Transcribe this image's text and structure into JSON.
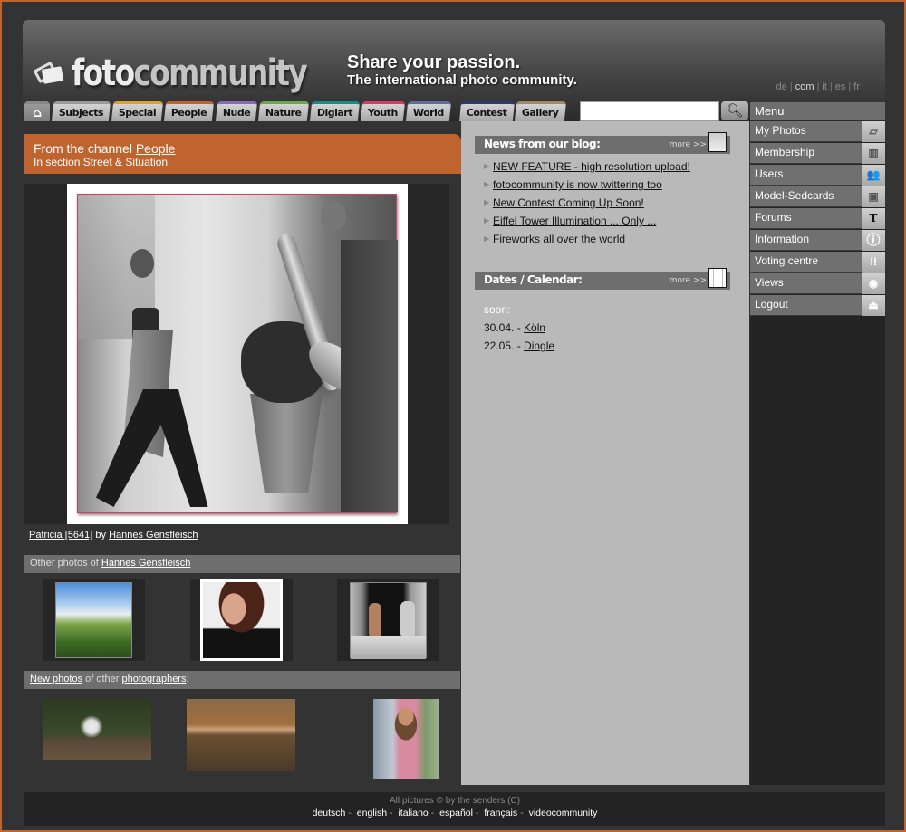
{
  "header": {
    "logo_foto": "foto",
    "logo_community": "community",
    "tagline_main": "Share your passion.",
    "tagline_sub": "The international photo community.",
    "languages": [
      "de",
      "com",
      "it",
      "es",
      "fr"
    ],
    "selected_language": "com"
  },
  "tabs": [
    {
      "label": "Subjects",
      "color": "#9a9a9a"
    },
    {
      "label": "Special",
      "color": "#e0a030"
    },
    {
      "label": "People",
      "color": "#c0642f"
    },
    {
      "label": "Nude",
      "color": "#8a6ab8"
    },
    {
      "label": "Nature",
      "color": "#6aa84f"
    },
    {
      "label": "Digiart",
      "color": "#138f8a"
    },
    {
      "label": "Youth",
      "color": "#d63c63"
    },
    {
      "label": "World",
      "color": "#5c6e9c"
    },
    {
      "label": "Contest",
      "color": "#2f3a6a"
    },
    {
      "label": "Gallery",
      "color": "#a08a64"
    }
  ],
  "search": {
    "value": "",
    "placeholder": ""
  },
  "channel": {
    "prefix": "From the channel",
    "channel_name": "People",
    "section_prefix": "In section Stree",
    "section_name": "t & Situation"
  },
  "main_photo": {
    "title": "Patricia [5641]",
    "by": "by",
    "author": "Hannes Gensfleisch"
  },
  "other_photos": {
    "prefix": "Other photos of",
    "author": "Hannes Gensfleisch",
    "thumbs": [
      "landscape",
      "portrait",
      "balcony"
    ]
  },
  "new_photos": {
    "link1": "New photos",
    "middle": "of other",
    "link2": "photographers",
    "suffix": ":",
    "thumbs": [
      "star-sculpture",
      "reclining-figure",
      "woman-portrait"
    ]
  },
  "blog": {
    "title": "News from our blog:",
    "more": "more >>",
    "items": [
      "NEW FEATURE - high resolution upload!",
      "fotocommunity is now twittering too",
      "New Contest Coming Up Soon!",
      "Eiffel Tower Illumination ... Only ...",
      "Fireworks all over the world"
    ]
  },
  "calendar": {
    "title": "Dates / Calendar:",
    "more": "more >>",
    "soon_label": "soon:",
    "events": [
      {
        "date": "30.04. -",
        "place": "Köln"
      },
      {
        "date": "22.05. -",
        "place": "Dingle"
      }
    ]
  },
  "menu": {
    "title": "Menu",
    "items": [
      {
        "label": "My Photos",
        "icon": "photos-icon",
        "glyph": "▱"
      },
      {
        "label": "Membership",
        "icon": "membership-icon",
        "glyph": "▥"
      },
      {
        "label": "Users",
        "icon": "users-icon",
        "glyph": "👥"
      },
      {
        "label": "Model-Sedcards",
        "icon": "sedcard-icon",
        "glyph": "▣"
      },
      {
        "label": "Forums",
        "icon": "forum-icon",
        "glyph": "T"
      },
      {
        "label": "Information",
        "icon": "info-icon",
        "glyph": "ⓘ"
      },
      {
        "label": "Voting centre",
        "icon": "voting-icon",
        "glyph": "!!"
      },
      {
        "label": "Views",
        "icon": "eye-icon",
        "glyph": "◉"
      },
      {
        "label": "Logout",
        "icon": "eject-icon",
        "glyph": "⏏"
      }
    ]
  },
  "footer": {
    "copyright": "All pictures © by the senders (C)",
    "links": [
      "deutsch",
      "english",
      "italiano",
      "español",
      "français",
      "videocommunity"
    ]
  }
}
